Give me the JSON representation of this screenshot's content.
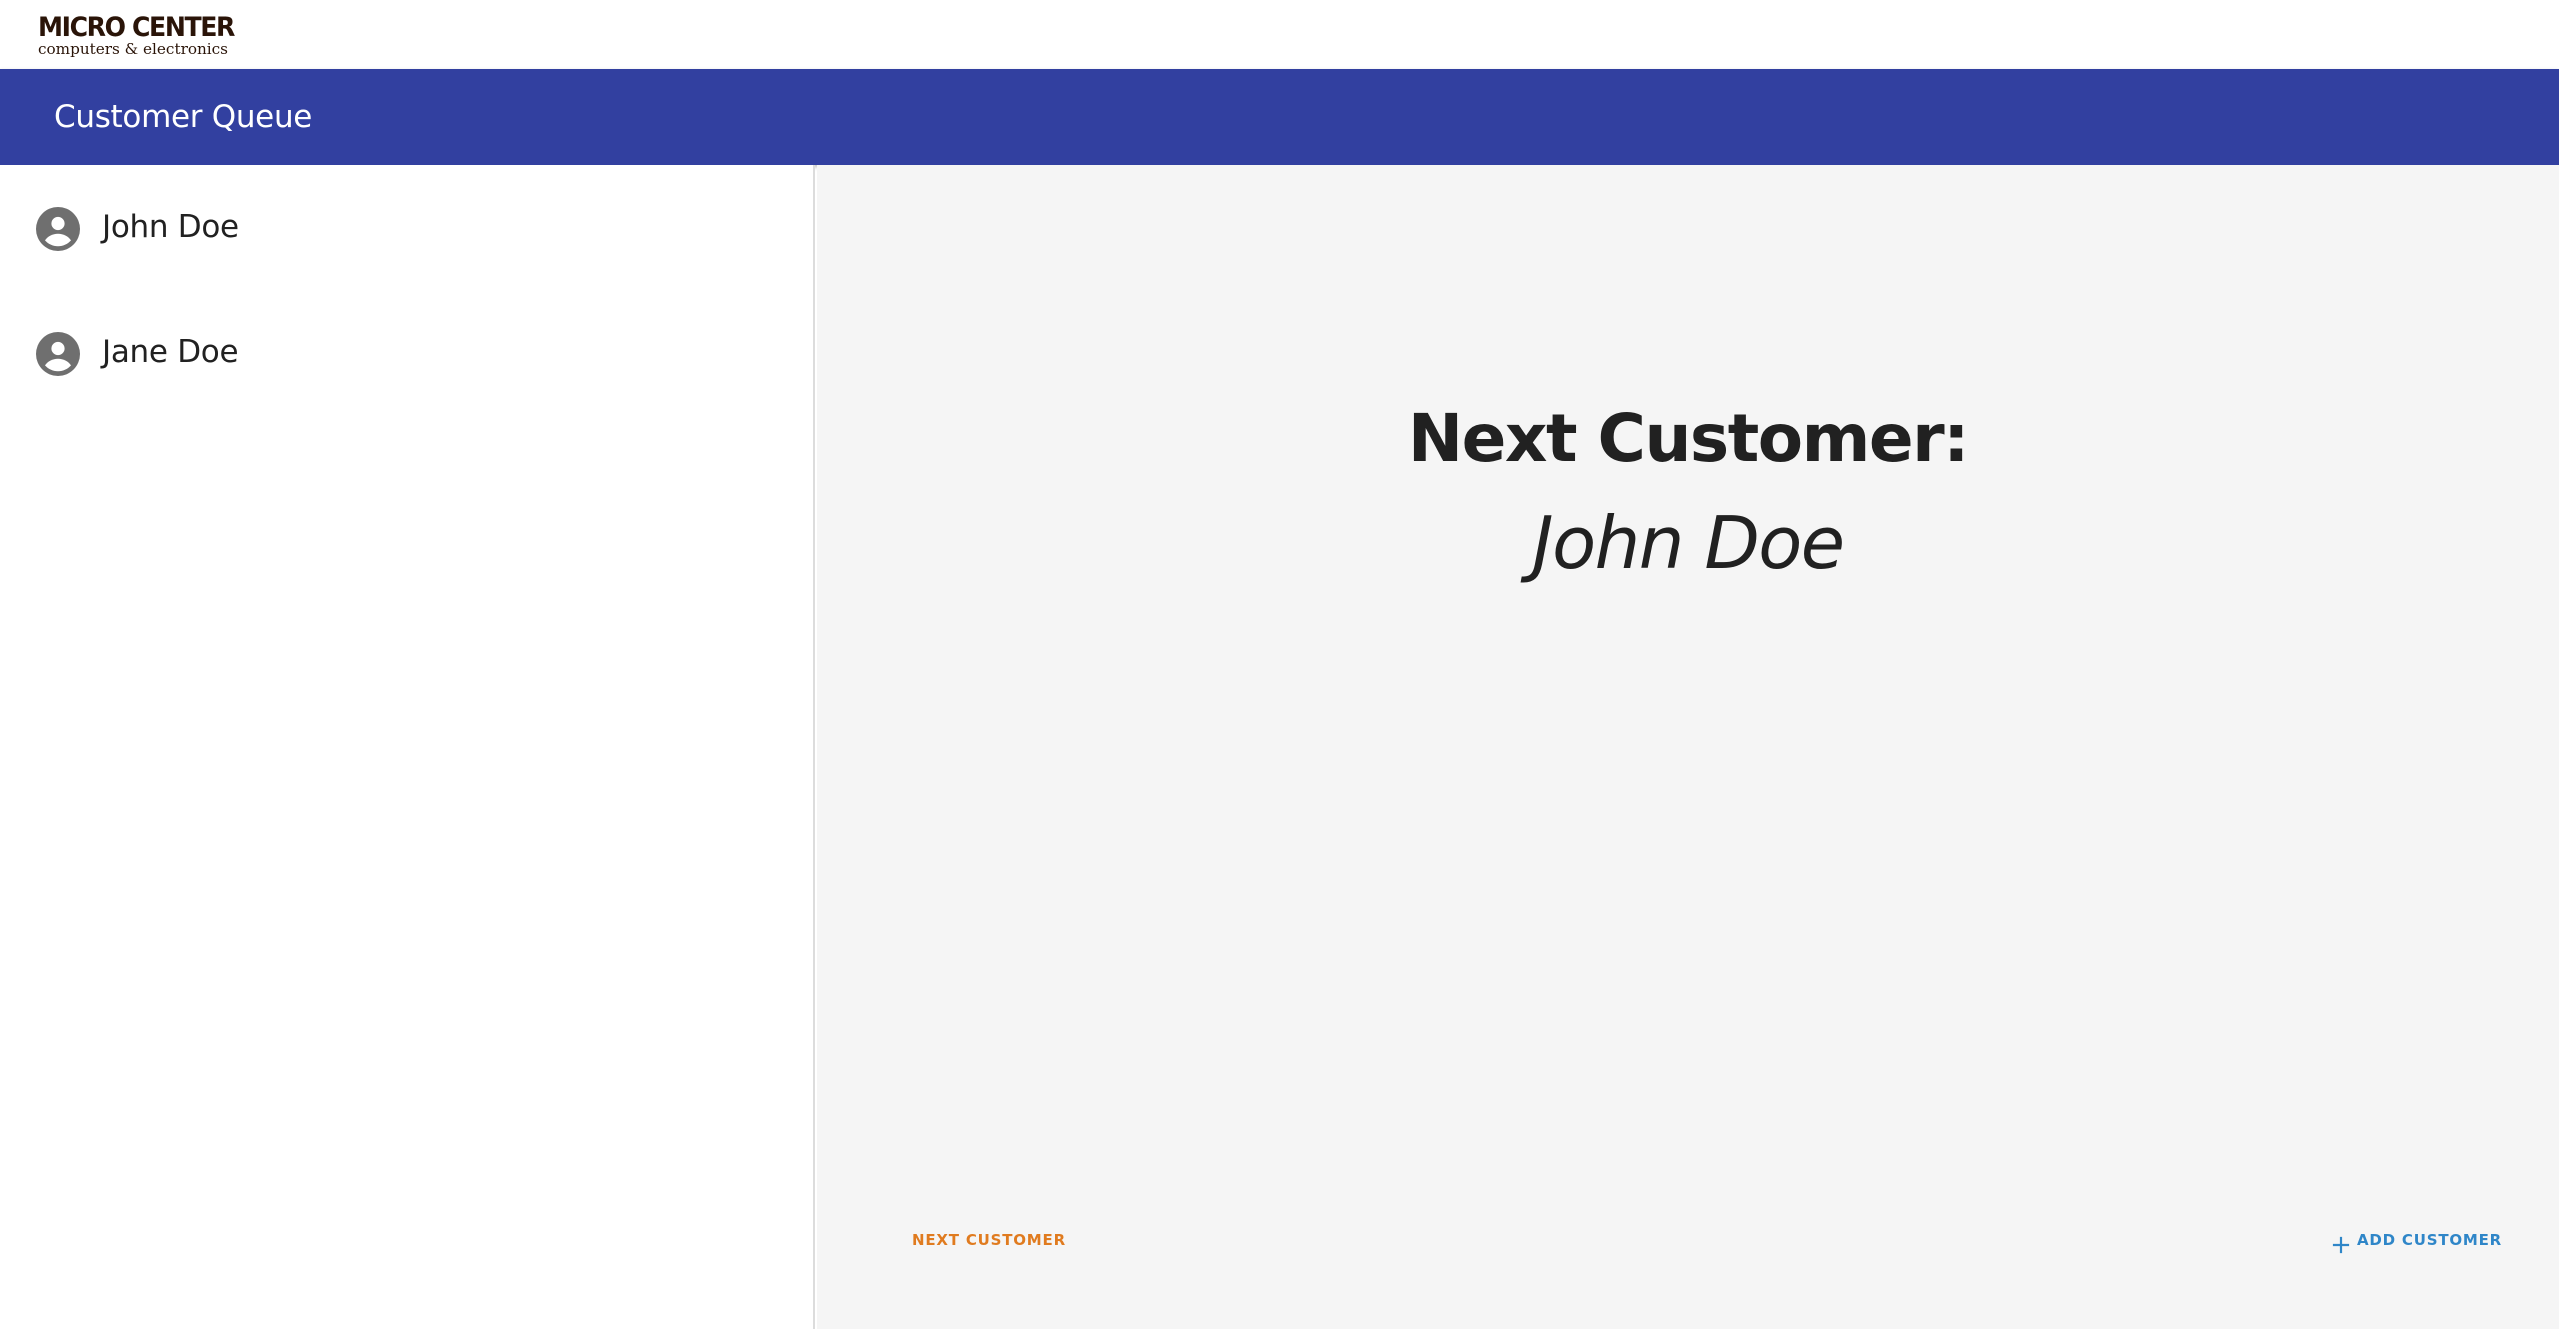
{
  "brand": {
    "logo_text": "MICRO CENTER",
    "logo_tagline": "computers & electronics",
    "logo_color": "#2a1408"
  },
  "appbar": {
    "title": "Customer Queue",
    "color": "#3240a0"
  },
  "queue": {
    "items": [
      {
        "name": "John Doe",
        "icon": "account-circle-icon"
      },
      {
        "name": "Jane Doe",
        "icon": "account-circle-icon"
      }
    ]
  },
  "main": {
    "next_label": "Next Customer:",
    "next_name": "John Doe"
  },
  "actions": {
    "next_customer_label": "NEXT CUSTOMER",
    "next_customer_color": "#e07b1f",
    "add_customer_label": "ADD CUSTOMER",
    "add_customer_icon": "plus-icon",
    "add_customer_color": "#2f86c8"
  }
}
